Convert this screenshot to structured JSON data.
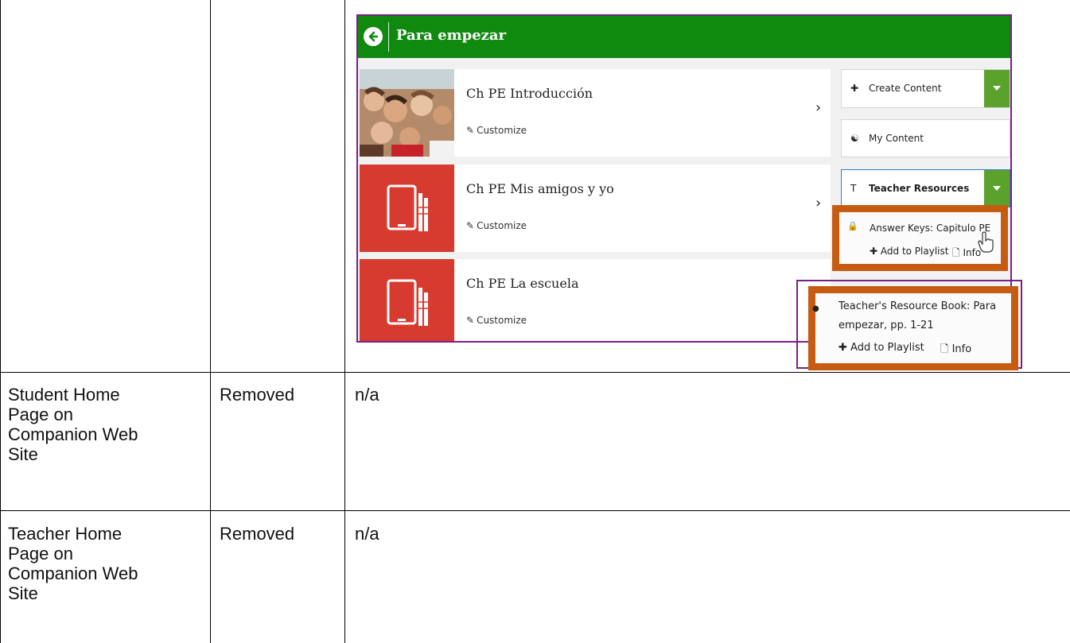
{
  "screenshot": {
    "header_title": "Para empezar",
    "lessons": [
      {
        "title": "Ch PE Introducción",
        "customize": "Customize"
      },
      {
        "title": "Ch PE Mis amigos y yo",
        "customize": "Customize"
      },
      {
        "title": "Ch PE La escuela",
        "customize": "Customize"
      }
    ],
    "side_buttons": {
      "create_content": "Create Content",
      "my_content": "My Content",
      "teacher_resources": "Teacher Resources",
      "teacher_resources_lead": "T"
    },
    "popup1": {
      "title": "Answer Keys: Capitulo PE",
      "add": "Add to Playlist",
      "info": "Info"
    },
    "popup2": {
      "line1": "Teacher's Resource Book: Para",
      "line2": "empezar, pp. 1-21",
      "add": "Add to Playlist",
      "info": "Info"
    },
    "colors": {
      "header": "#0f8a0f",
      "accent_green": "#5aa22b",
      "lesson_red": "#d73a2f",
      "frame_purple": "#7b1f86",
      "frame_orange": "#c65c12"
    }
  },
  "table": {
    "rows": [
      {
        "feature": [
          "Student Home",
          "Page on",
          "Companion Web",
          "Site"
        ],
        "status": "Removed",
        "notes": "n/a"
      },
      {
        "feature": [
          "Teacher Home",
          "Page on",
          "Companion Web",
          "Site"
        ],
        "status": "Removed",
        "notes": "n/a"
      }
    ]
  }
}
